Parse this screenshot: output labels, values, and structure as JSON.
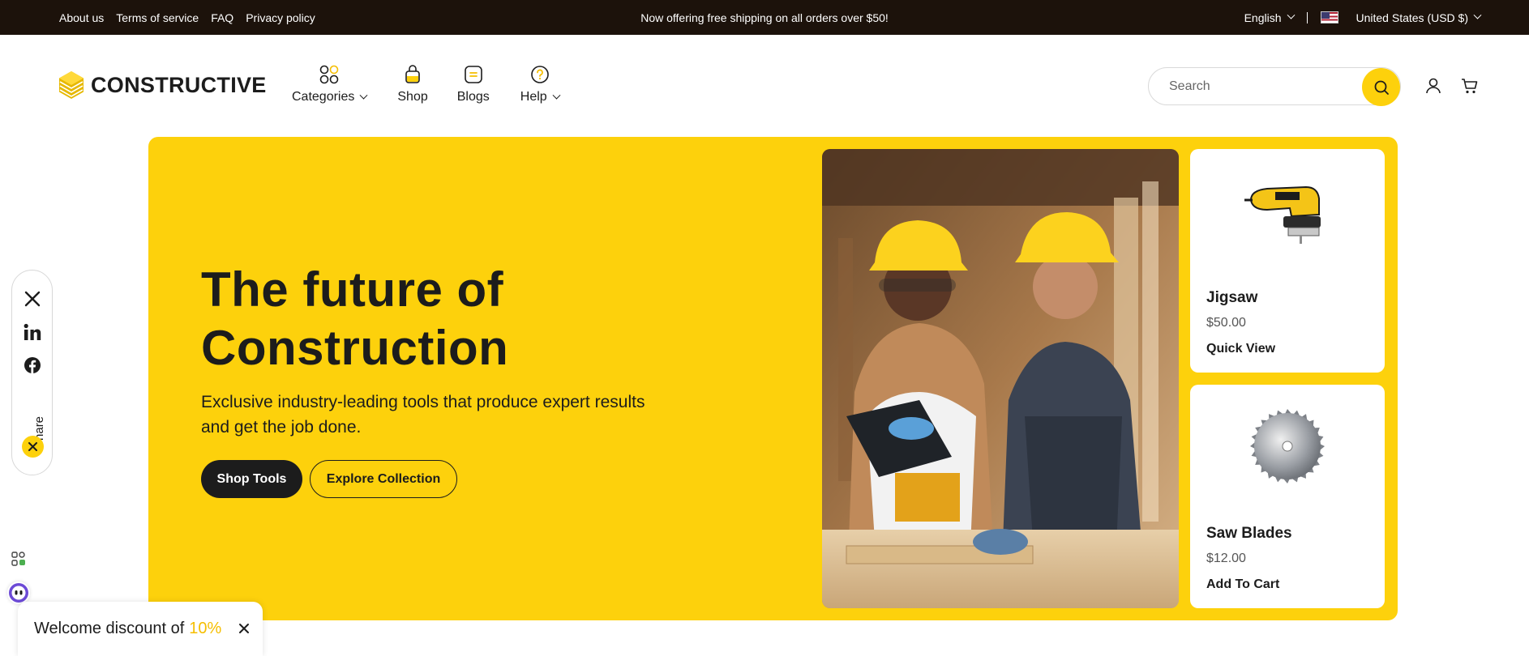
{
  "announcement": {
    "links": [
      {
        "label": "About us"
      },
      {
        "label": "Terms of service"
      },
      {
        "label": "FAQ"
      },
      {
        "label": "Privacy policy"
      }
    ],
    "message": "Now offering free shipping on all orders over $50!",
    "language": "English",
    "country": "United States (USD $)"
  },
  "header": {
    "brand": "CONSTRUCTIVE",
    "nav": [
      {
        "label": "Categories",
        "icon": "grid-icon"
      },
      {
        "label": "Shop",
        "icon": "bag-icon"
      },
      {
        "label": "Blogs",
        "icon": "document-icon"
      },
      {
        "label": "Help",
        "icon": "question-icon"
      }
    ],
    "search_placeholder": "Search"
  },
  "hero": {
    "title_line1": "The future of",
    "title_line2": "Construction",
    "subtitle": "Exclusive industry-leading tools that produce expert results and get the job done.",
    "primary_cta": "Shop Tools",
    "secondary_cta": "Explore Collection"
  },
  "products": [
    {
      "name": "Jigsaw",
      "price": "$50.00",
      "cta": "Quick View"
    },
    {
      "name": "Saw Blades",
      "price": "$12.00",
      "cta": "Add To Cart"
    }
  ],
  "share": {
    "label": "Share",
    "networks": [
      "x-icon",
      "linkedin-icon",
      "facebook-icon"
    ]
  },
  "discount": {
    "text": "Welcome discount of",
    "percent": "10%"
  },
  "colors": {
    "accent": "#fdd10c",
    "dark": "#1c1c1c",
    "topbar": "#1c120b"
  }
}
